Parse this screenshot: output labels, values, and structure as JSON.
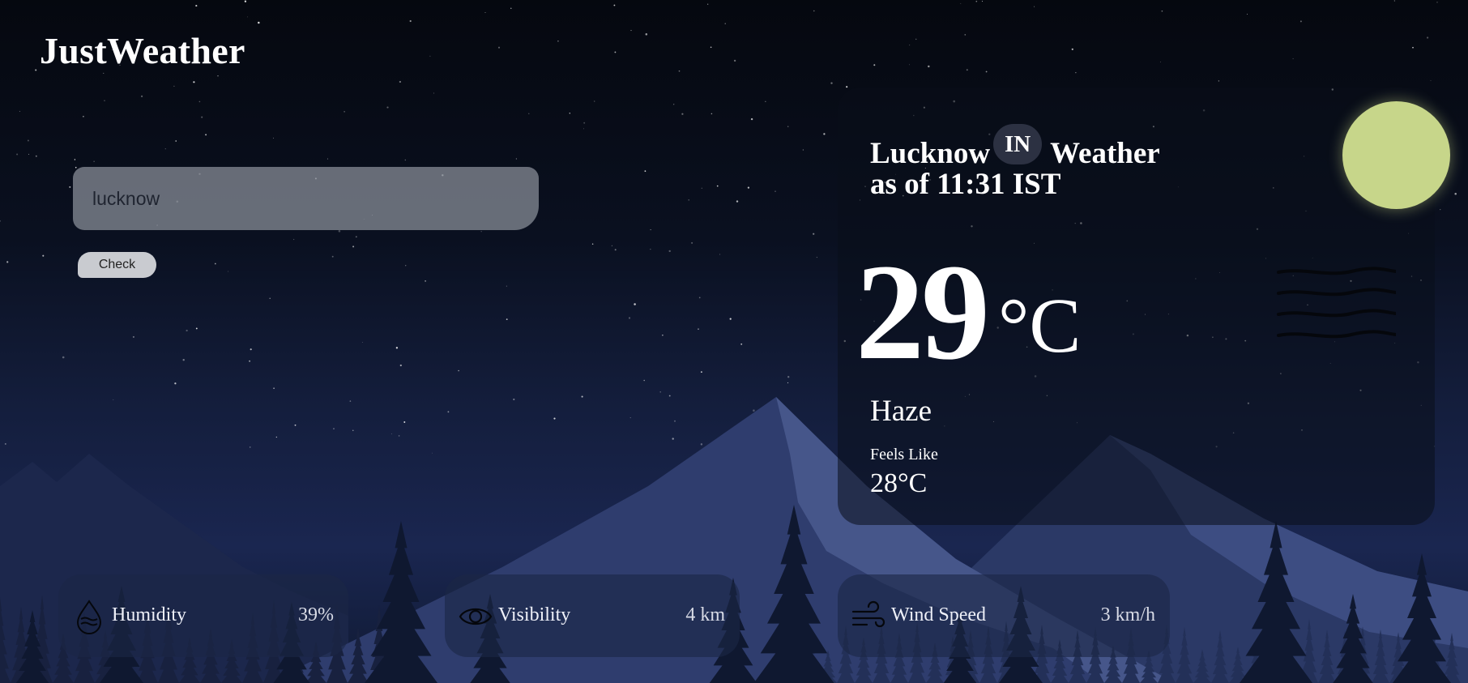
{
  "app": {
    "title": "JustWeather"
  },
  "search": {
    "value": "lucknow",
    "button_label": "Check"
  },
  "weather": {
    "city": "Lucknow",
    "country_code": "IN",
    "heading_suffix": "Weather",
    "as_of": "as of 11:31 IST",
    "temperature": "29",
    "temperature_unit": "°C",
    "condition": "Haze",
    "feels_like_label": "Feels Like",
    "feels_like_value": "28°C"
  },
  "stats": [
    {
      "icon": "humidity-drop-icon",
      "label": "Humidity",
      "value": "39%"
    },
    {
      "icon": "eye-icon",
      "label": "Visibility",
      "value": "4 km"
    },
    {
      "icon": "wind-icon",
      "label": "Wind Speed",
      "value": "3 km/h"
    }
  ],
  "colors": {
    "sky_top": "#05080f",
    "mountain": "#3d4d82",
    "moon": "#c7d68a",
    "card_bg": "#0a0e1a",
    "input_bg": "#8c919b",
    "button_bg": "#c9cbd0"
  }
}
